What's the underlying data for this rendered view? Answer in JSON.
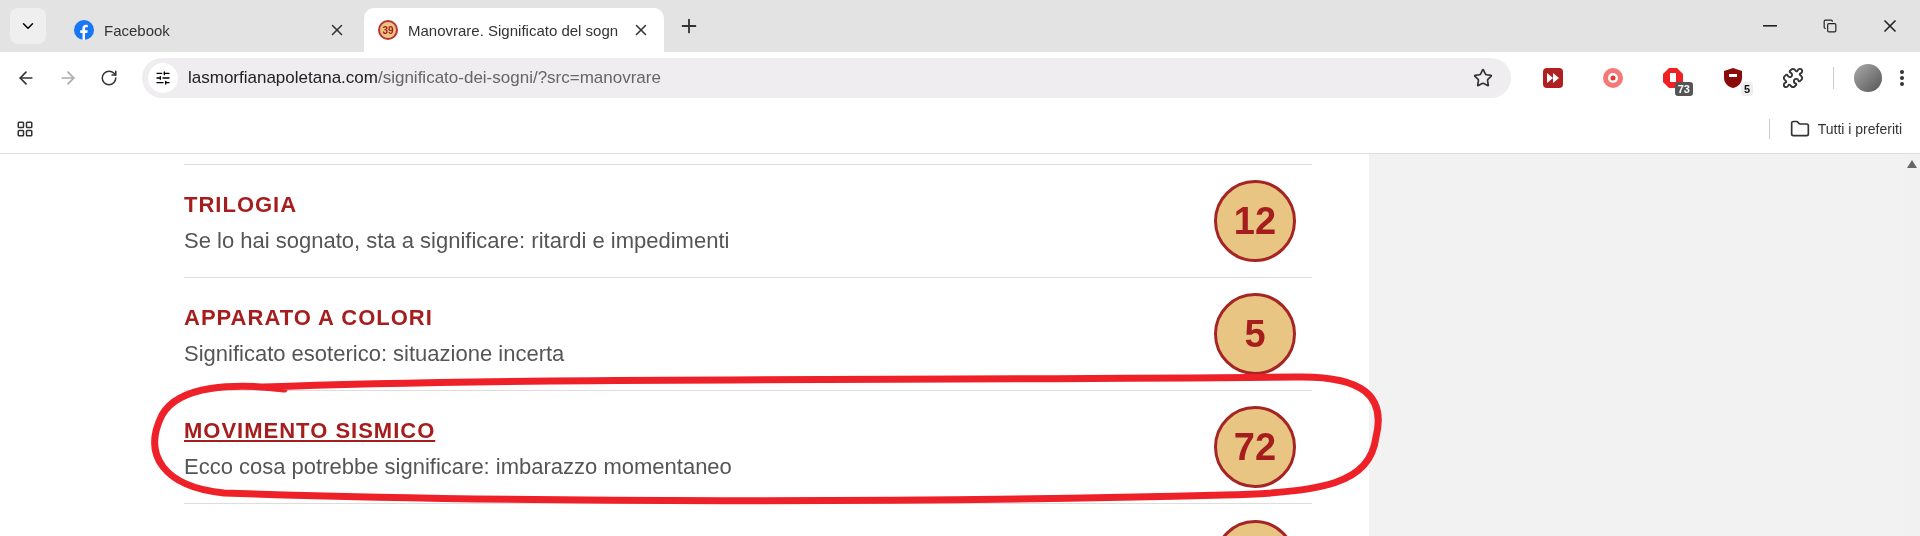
{
  "tabs": [
    {
      "title": "Facebook",
      "selected": false
    },
    {
      "title": "Manovrare. Significato del sogn",
      "favicon_text": "39",
      "selected": true
    }
  ],
  "address": {
    "host": "lasmorfianapoletana.com",
    "path": "/significato-dei-sogni/?src=manovrare"
  },
  "extensions": [
    {
      "kind": "forward"
    },
    {
      "kind": "record"
    },
    {
      "kind": "stop",
      "badge": "73"
    },
    {
      "kind": "shield",
      "badge": "5"
    },
    {
      "kind": "puzzle"
    }
  ],
  "bookmarks": {
    "folder": "Tutti i preferiti"
  },
  "dreams": [
    {
      "title": "TRILOGIA",
      "meaning": "Se lo hai sognato, sta a significare: ritardi e impedimenti",
      "number": "12",
      "underlined": false,
      "circled": false
    },
    {
      "title": "APPARATO A COLORI",
      "meaning": "Significato esoterico: situazione incerta",
      "number": "5",
      "underlined": false,
      "circled": false
    },
    {
      "title": "MOVIMENTO SISMICO",
      "meaning": "Ecco cosa potrebbe significare: imbarazzo momentaneo",
      "number": "72",
      "underlined": true,
      "circled": true
    }
  ]
}
